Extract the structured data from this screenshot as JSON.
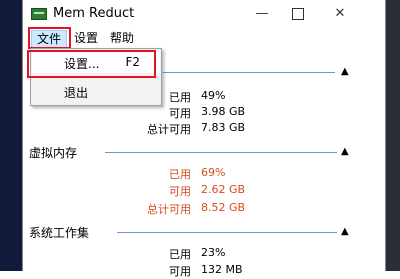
{
  "window": {
    "title": "Mem Reduct"
  },
  "menu": {
    "file": "文件",
    "settings": "设置",
    "help": "帮助"
  },
  "dropdown": {
    "settings_label": "设置...",
    "settings_shortcut": "F2",
    "exit_label": "退出"
  },
  "groups": [
    {
      "title": "",
      "rows": [
        {
          "label": "已用",
          "value": "49%"
        },
        {
          "label": "可用",
          "value": "3.98 GB"
        },
        {
          "label": "总计可用",
          "value": "7.83 GB"
        }
      ]
    },
    {
      "title": "虚拟内存",
      "rows": [
        {
          "label": "已用",
          "value": "69%"
        },
        {
          "label": "可用",
          "value": "2.62 GB"
        },
        {
          "label": "总计可用",
          "value": "8.52 GB"
        }
      ]
    },
    {
      "title": "系统工作集",
      "rows": [
        {
          "label": "已用",
          "value": "23%"
        },
        {
          "label": "可用",
          "value": "132 MB"
        }
      ]
    }
  ],
  "colors": {
    "warning": "#d84a1b",
    "accent": "#6e9ad2",
    "highlight": "#e81123"
  },
  "icons": {
    "app": "memory-chip-icon",
    "minimize": "minimize-icon",
    "maximize": "maximize-icon",
    "close": "close-icon",
    "chevron": "chevron-up-icon"
  }
}
